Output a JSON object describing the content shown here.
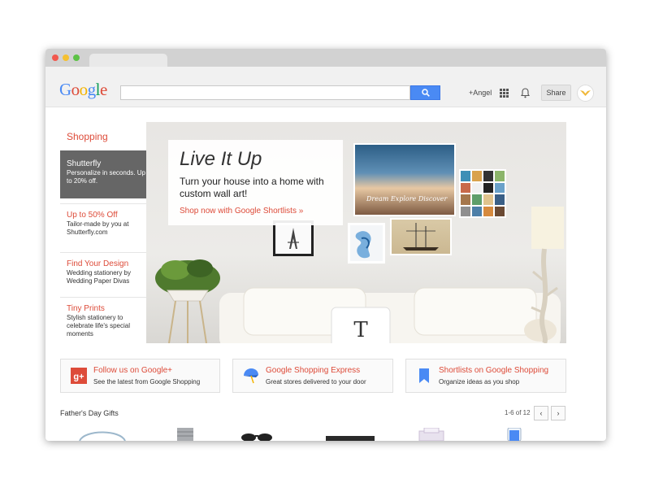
{
  "header": {
    "logo_text": "Google",
    "search": {
      "value": "",
      "placeholder": ""
    },
    "user_label": "+Angel",
    "share_label": "Share"
  },
  "sidebar": {
    "title": "Shopping",
    "items": [
      {
        "title": "Shutterfly",
        "desc": "Personalize in seconds. Up to 20% off.",
        "active": true
      },
      {
        "title": "Up to 50% Off",
        "desc": "Tailor-made by you at Shutterfly.com"
      },
      {
        "title": "Find Your Design",
        "desc": "Wedding stationery by Wedding Paper Divas"
      },
      {
        "title": "Tiny Prints",
        "desc": "Stylish stationery to celebrate life's special moments"
      }
    ]
  },
  "hero": {
    "title": "Live It Up",
    "subtitle": "Turn your house into a home with custom wall art!",
    "link": "Shop now with Google Shortlists »",
    "art_caption": "Dream Explore Discover",
    "pillow_letter": "T"
  },
  "features": [
    {
      "title": "Follow us on Google+",
      "subtitle": "See the latest from Google Shopping",
      "icon": "google-plus-icon",
      "color": "#dd4b39"
    },
    {
      "title": "Google Shopping Express",
      "subtitle": "Great stores delivered to your door",
      "icon": "express-umbrella-icon",
      "color": "#4a8af4"
    },
    {
      "title": "Shortlists on Google Shopping",
      "subtitle": "Organize ideas as you shop",
      "icon": "bookmark-icon",
      "color": "#4a8af4"
    }
  ],
  "gifts": {
    "title": "Father's Day Gifts",
    "pager": "1-6 of 12",
    "prev": "‹",
    "next": "›"
  },
  "colors": {
    "accent": "#dd4b39",
    "blue": "#4a8af4",
    "active_nav": "#666666"
  }
}
